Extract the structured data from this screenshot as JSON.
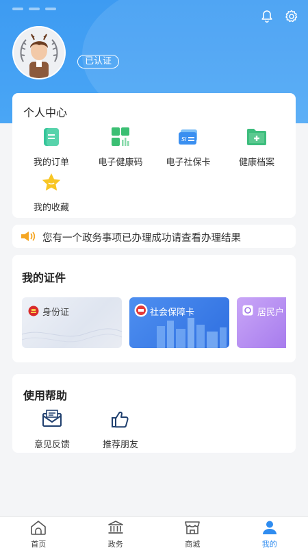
{
  "profile": {
    "verified_label": "已认证"
  },
  "personal_center": {
    "title": "个人中心",
    "items": [
      {
        "label": "我的订单",
        "icon": "order-icon"
      },
      {
        "label": "电子健康码",
        "icon": "health-code-icon"
      },
      {
        "label": "电子社保卡",
        "icon": "social-card-icon"
      },
      {
        "label": "健康档案",
        "icon": "health-record-icon"
      },
      {
        "label": "我的收藏",
        "icon": "star-icon"
      }
    ]
  },
  "notice": {
    "text": "您有一个政务事项已办理成功请查看办理结果",
    "icon": "speaker-icon"
  },
  "certificates": {
    "title": "我的证件",
    "items": [
      {
        "label": "身份证"
      },
      {
        "label": "社会保障卡"
      },
      {
        "label": "居民户"
      }
    ]
  },
  "help": {
    "title": "使用帮助",
    "items": [
      {
        "label": "意见反馈",
        "icon": "feedback-mail-icon"
      },
      {
        "label": "推荐朋友",
        "icon": "thumbs-up-icon"
      }
    ]
  },
  "tabbar": {
    "items": [
      {
        "label": "首页",
        "icon": "home-icon"
      },
      {
        "label": "政务",
        "icon": "government-building-icon"
      },
      {
        "label": "商城",
        "icon": "shop-icon"
      },
      {
        "label": "我的",
        "icon": "user-icon"
      }
    ],
    "active_index": 3
  },
  "colors": {
    "header_blue": "#3d9bf2",
    "active_tab": "#2f8cf0",
    "green": "#3dbd7d",
    "social_blue": "#3a8ff0",
    "purple": "#b48df0"
  }
}
